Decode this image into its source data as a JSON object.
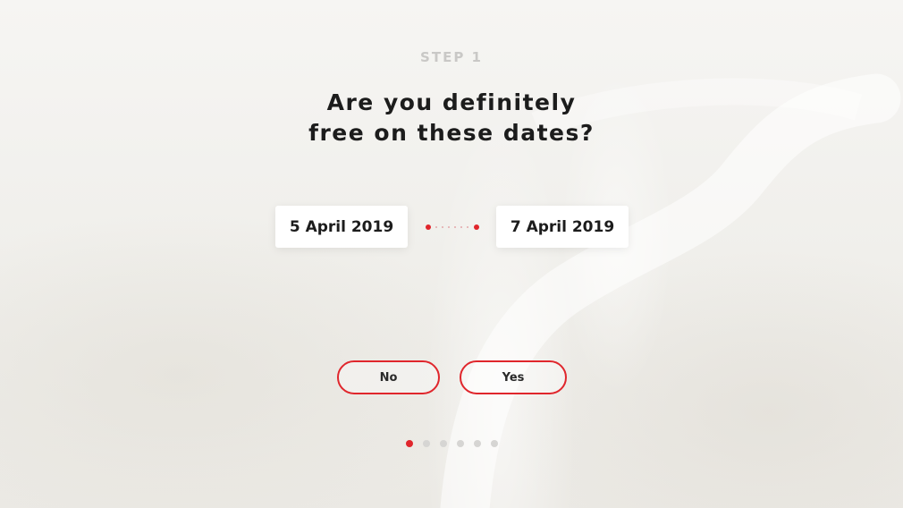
{
  "step": {
    "label": "STEP 1"
  },
  "question": {
    "line1": "Are you definitely",
    "line2": "free on these dates?"
  },
  "dates": {
    "start": "5 April 2019",
    "end": "7 April 2019"
  },
  "buttons": {
    "no_label": "No",
    "yes_label": "Yes"
  },
  "pagination": {
    "total": 6,
    "active_index": 0
  },
  "colors": {
    "accent": "#e0262c",
    "text": "#1c1c1c",
    "muted": "#c9c8c6",
    "inactive_dot": "#d6d5d3"
  },
  "icons": {
    "connector": "dotted-range-connector-icon"
  }
}
